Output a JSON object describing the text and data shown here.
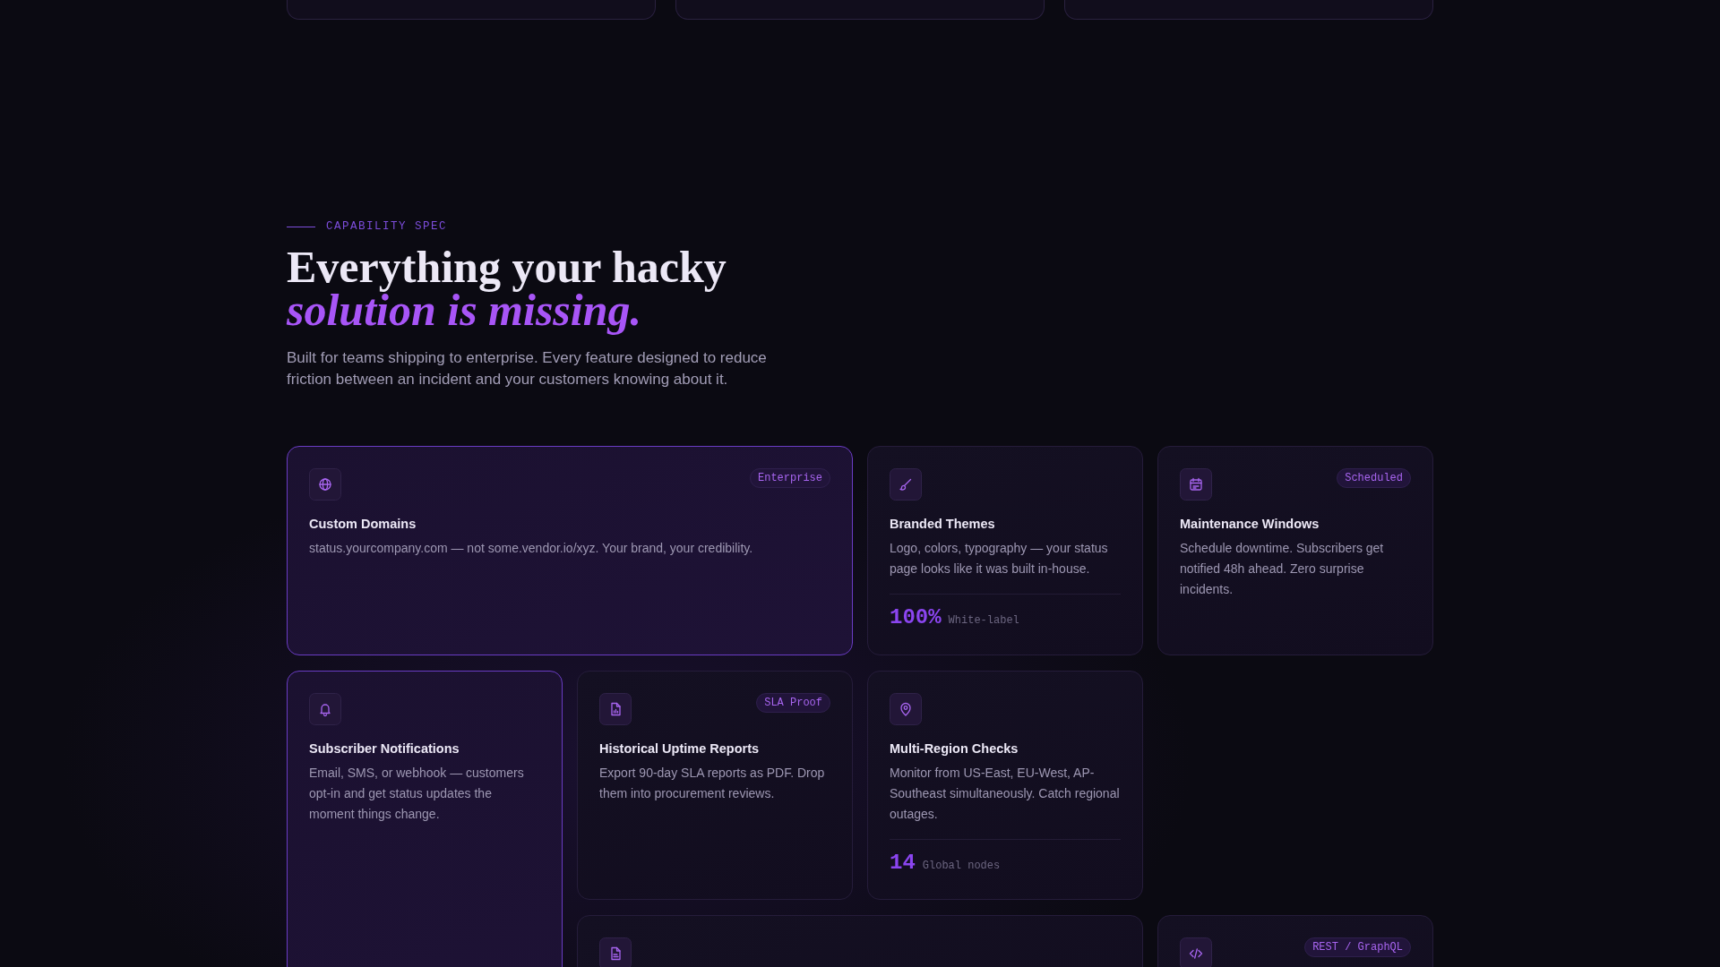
{
  "section": {
    "eyebrow": "CAPABILITY SPEC",
    "heading_line_1": "Everything your hacky",
    "heading_line_2": "solution is missing.",
    "intro": "Built for teams shipping to enterprise. Every feature designed to reduce friction between an incident and your customers knowing about it."
  },
  "features": [
    {
      "title": "Custom Domains",
      "description": "status.yourcompany.com — not some.vendor.io/xyz. Your brand, your credibility.",
      "badge": "Enterprise",
      "highlighted": true
    },
    {
      "title": "Branded Themes",
      "description": "Logo, colors, typography — your status page looks like it was built in-house.",
      "highlighted": false,
      "stat": {
        "value": "100%",
        "label": "White-label"
      }
    },
    {
      "title": "Maintenance Windows",
      "description": "Schedule downtime. Subscribers get notified 48h ahead. Zero surprise incidents.",
      "badge": "Scheduled",
      "highlighted": false
    },
    {
      "title": "Subscriber Notifications",
      "description": "Email, SMS, or webhook — customers opt-in and get status updates the moment things change.",
      "highlighted": true
    },
    {
      "title": "Historical Uptime Reports",
      "description": "Export 90-day SLA reports as PDF. Drop them into procurement reviews.",
      "badge": "SLA Proof",
      "highlighted": false
    },
    {
      "title": "Multi-Region Checks",
      "description": "Monitor from US-East, EU-West, AP-Southeast simultaneously. Catch regional outages.",
      "highlighted": false,
      "stat": {
        "value": "14",
        "label": "Global nodes"
      }
    },
    {
      "highlighted": false
    },
    {
      "badge": "REST / GraphQL",
      "highlighted": false
    }
  ]
}
